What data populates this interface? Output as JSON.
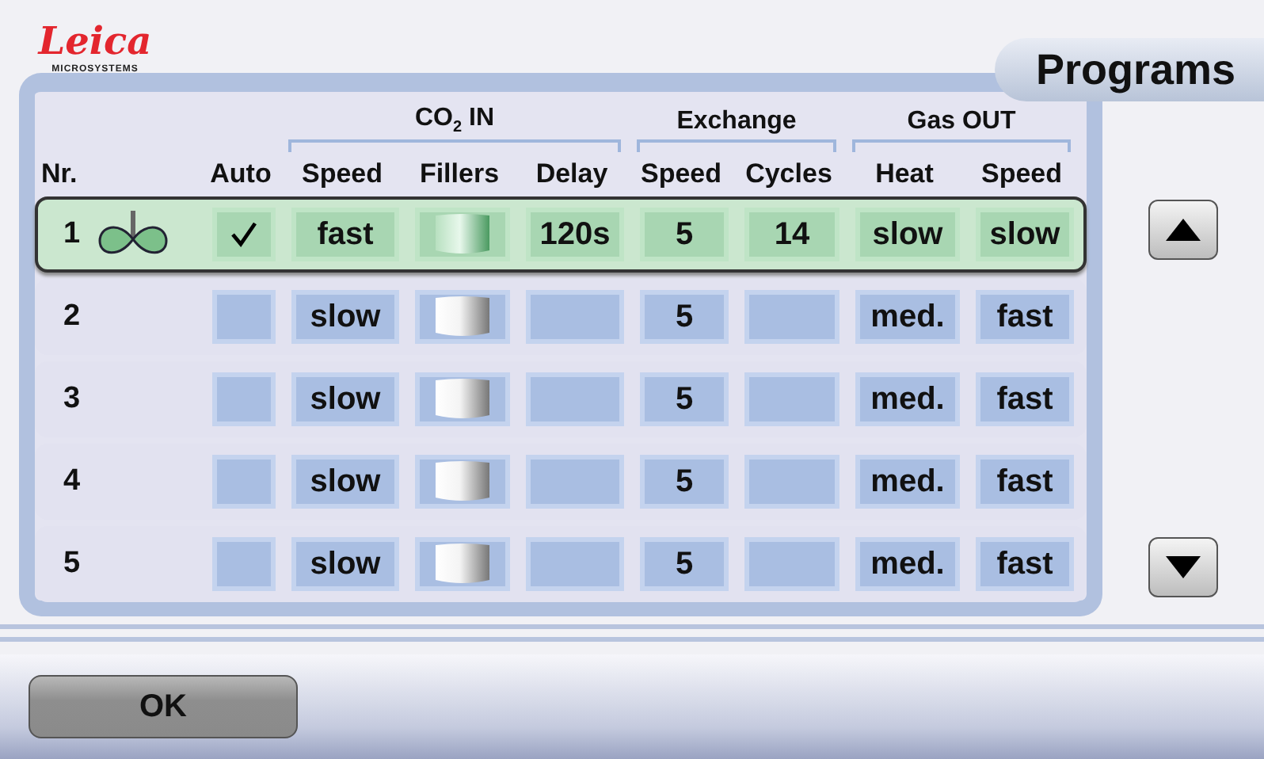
{
  "logo": {
    "name": "Leica",
    "tagline": "MICROSYSTEMS"
  },
  "title": "Programs",
  "headers": [
    {
      "label": "Nr."
    },
    {
      "label": "Auto"
    },
    {
      "group": "CO$_{2}$ IN",
      "columns": [
        "Speed",
        "Fillers",
        "Delay"
      ]
    },
    {
      "group": "Exchange",
      "columns": [
        "Speed",
        "Cycles"
      ]
    },
    {
      "group": "Gas OUT",
      "columns": [
        "Heat",
        "Speed"
      ]
    }
  ],
  "rows": [
    {
      "number": "1",
      "selected": true,
      "auto": true,
      "co2_speed": "fast",
      "delay": "120s",
      "exchange_speed": "5",
      "cycles": "14",
      "heat": "slow",
      "gas_speed": "slow"
    },
    {
      "number": "2",
      "selected": false,
      "auto": false,
      "co2_speed": "slow",
      "exchange_speed": "5",
      "heat": "med.",
      "gas_speed": "fast"
    },
    {
      "number": "3",
      "selected": false,
      "auto": false,
      "co2_speed": "slow",
      "exchange_speed": "5",
      "heat": "med.",
      "gas_speed": "fast"
    },
    {
      "number": "4",
      "selected": false,
      "auto": false,
      "co2_speed": "slow",
      "exchange_speed": "5",
      "heat": "med.",
      "gas_speed": "fast"
    },
    {
      "number": "5",
      "selected": false,
      "auto": false,
      "co2_speed": "slow",
      "exchange_speed": "5",
      "heat": "med.",
      "gas_speed": "fast"
    }
  ],
  "buttons": [
    {
      "label": "OK"
    }
  ]
}
